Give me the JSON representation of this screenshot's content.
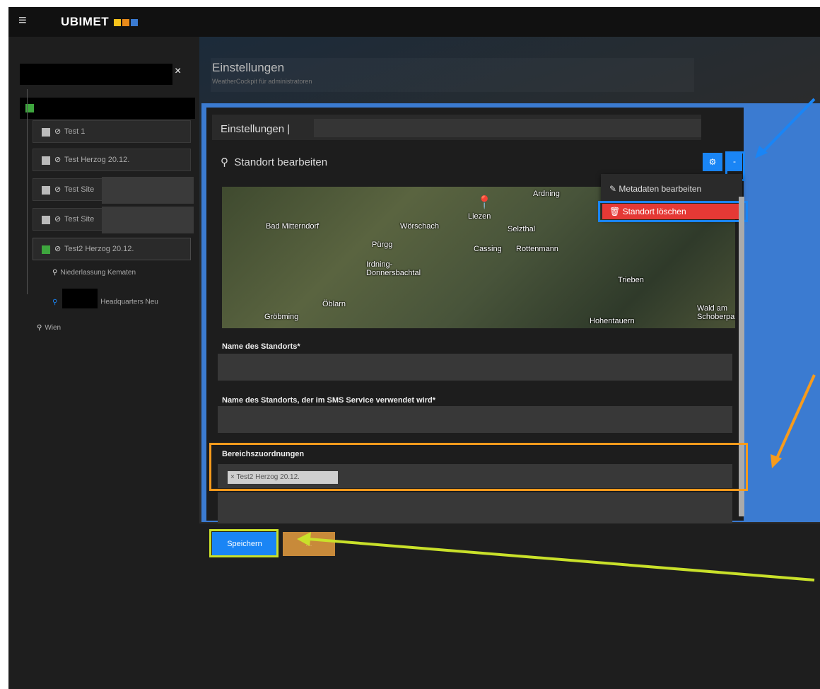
{
  "app": {
    "brand": "UBIMET",
    "menu_icon": "hamburger-icon"
  },
  "sidebar": {
    "search_close": "×",
    "items": [
      {
        "label": "Test 1",
        "box": "grey"
      },
      {
        "label": "Test Herzog 20.12.",
        "box": "grey"
      },
      {
        "label": "Test Site",
        "box": "grey"
      },
      {
        "label": "Test Site",
        "box": "grey"
      },
      {
        "label": "Test2 Herzog 20.12.",
        "box": "green"
      }
    ],
    "leaves": [
      "Niederlassung Kematen",
      "Headquarters Neu",
      "Wien"
    ]
  },
  "header": {
    "title": "Einstellungen",
    "subtitle": "WeatherCockpit für administratoren"
  },
  "panel": {
    "title": "Einstellungen |",
    "section_title": "Standort bearbeiten",
    "gear_icon": "gear-icon",
    "dropdown_toggle": "-",
    "dropdown": {
      "edit_metadata": "Metadaten bearbeiten",
      "delete_location": "Standort löschen"
    }
  },
  "map": {
    "labels": [
      "Ardning",
      "Liezen",
      "Bad Mitterndorf",
      "Wörschach",
      "Selzthal",
      "Pürgg",
      "Cassing",
      "Rottenmann",
      "Irdning-Donnersbachtal",
      "Trieben",
      "Öblarn",
      "Gröbming",
      "Hohentauern",
      "Wald am Schoberpass"
    ]
  },
  "form": {
    "name_label": "Name des Standorts*",
    "sms_label": "Name des Standorts, der im SMS Service verwendet wird*",
    "areas_label": "Bereichszuordnungen",
    "area_tag": "× Test2 Herzog 20.12."
  },
  "footer": {
    "save_label": "Speichern",
    "cancel_label": "..."
  },
  "colors": {
    "accent_blue": "#1a85f5",
    "danger_red": "#e53935",
    "highlight_orange": "#f79b1c",
    "highlight_lime": "#c9e02a"
  }
}
